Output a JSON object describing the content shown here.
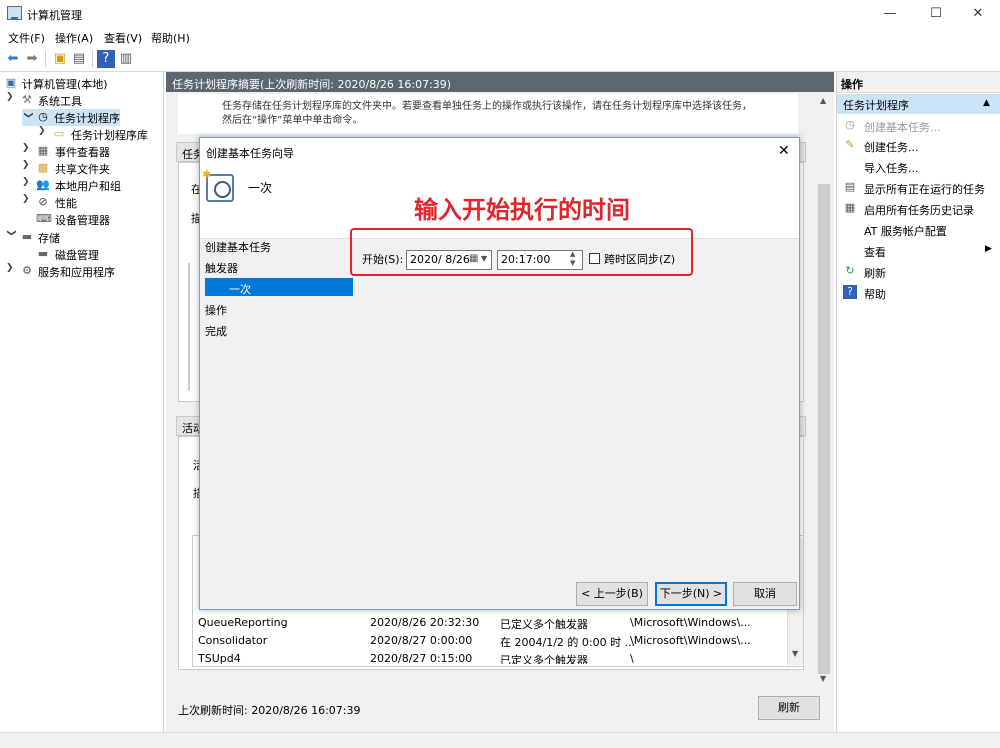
{
  "window": {
    "title": "计算机管理",
    "minimize": "—",
    "maximize": "☐",
    "close": "✕"
  },
  "menu": [
    "文件(F)",
    "操作(A)",
    "查看(V)",
    "帮助(H)"
  ],
  "tree": {
    "root": "计算机管理(本地)",
    "system_tools": "系统工具",
    "task_scheduler": "任务计划程序",
    "task_library": "任务计划程序库",
    "event_viewer": "事件查看器",
    "shared_folders": "共享文件夹",
    "local_users": "本地用户和组",
    "performance": "性能",
    "device_manager": "设备管理器",
    "storage": "存储",
    "disk_mgmt": "磁盘管理",
    "services_apps": "服务和应用程序"
  },
  "center": {
    "header": "任务计划程序摘要(上次刷新时间: 2020/8/26 16:07:39)",
    "intro_line1": "任务存储在任务计划程序库的文件夹中。若要查看单独任务上的操作或执行该操作，请在任务计划程序库中选择该任务，",
    "intro_line2": "然后在“操作”菜单中单击命令。",
    "box1_head": "任务",
    "box1_line1": "在",
    "box1_line2": "描",
    "box2_head": "活动",
    "box2_line1": "活",
    "box2_line2": "描",
    "last_refresh": "上次刷新时间: 2020/8/26 16:07:39",
    "refresh_button": "刷新",
    "tasks": [
      {
        "name": "QueueReporting",
        "time": "2020/8/26 20:32:30",
        "trigger": "已定义多个触发器",
        "path": "\\Microsoft\\Windows\\..."
      },
      {
        "name": "Consolidator",
        "time": "2020/8/27 0:00:00",
        "trigger": "在 2004/1/2 的 0:00 时 ...",
        "path": "\\Microsoft\\Windows\\..."
      },
      {
        "name": "TSUpd4",
        "time": "2020/8/27 0:15:00",
        "trigger": "已定义多个触发器",
        "path": "\\"
      }
    ]
  },
  "dialog": {
    "title": "创建基本任务向导",
    "close": "✕",
    "heading": "一次",
    "steps": [
      "创建基本任务",
      "触发器",
      "一次",
      "操作",
      "完成"
    ],
    "start_label": "开始(S):",
    "date_value": "2020/ 8/26",
    "time_value": "20:17:00",
    "sync_label": "跨时区同步(Z)",
    "back_button": "< 上一步(B)",
    "next_button": "下一步(N) >",
    "cancel_button": "取消"
  },
  "annotation": "输入开始执行的时间",
  "actions": {
    "header": "操作",
    "section": "任务计划程序",
    "items": [
      {
        "label": "创建基本任务...",
        "icon": "wizard-icon",
        "disabled": true
      },
      {
        "label": "创建任务...",
        "icon": "task-icon",
        "disabled": false
      },
      {
        "label": "导入任务...",
        "icon": "",
        "disabled": false
      },
      {
        "label": "显示所有正在运行的任务",
        "icon": "running-icon",
        "disabled": false
      },
      {
        "label": "启用所有任务历史记录",
        "icon": "history-icon",
        "disabled": false
      },
      {
        "label": "AT 服务帐户配置",
        "icon": "",
        "disabled": false
      },
      {
        "label": "查看",
        "icon": "",
        "disabled": false
      },
      {
        "label": "刷新",
        "icon": "refresh-icon",
        "disabled": false
      },
      {
        "label": "帮助",
        "icon": "help-icon",
        "disabled": false
      }
    ]
  },
  "colors": {
    "accent": "#0078d7",
    "annotation": "#e2252c",
    "header_bar": "#5b6670",
    "section_bg": "#cce4f7"
  }
}
